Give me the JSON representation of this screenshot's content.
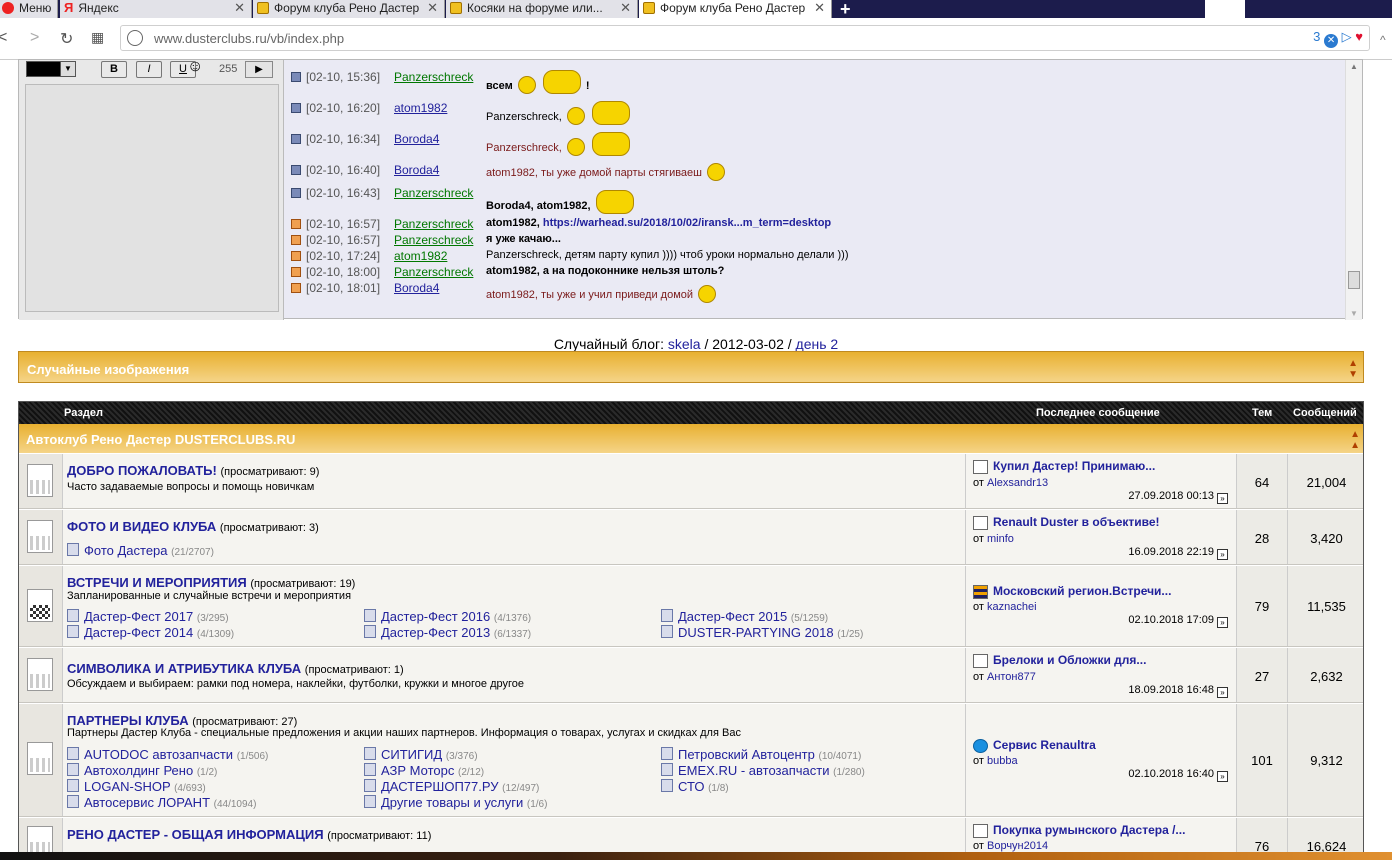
{
  "browser": {
    "tabs": [
      {
        "label": "Меню"
      },
      {
        "label": "Яндекс"
      },
      {
        "label": "Форум клуба Рено Дастер"
      },
      {
        "label": "Косяки на форуме или..."
      },
      {
        "label": "Форум клуба Рено Дастер"
      }
    ],
    "url": "www.dusterclubs.ru/vb/index.php",
    "ext_count": "3"
  },
  "chat": {
    "editor": {
      "bold": "B",
      "italic": "I",
      "underline": "U",
      "char_count": "255"
    },
    "messages": [
      {
        "time": "[02-10, 15:36]",
        "user": "Panzerschreck",
        "text": "всем",
        "style": "bold"
      },
      {
        "time": "[02-10, 16:20]",
        "user": "atom1982",
        "text": "Panzerschreck,",
        "style": "normal"
      },
      {
        "time": "[02-10, 16:34]",
        "user": "Boroda4",
        "text": "Panzerschreck,",
        "style": "red"
      },
      {
        "time": "[02-10, 16:40]",
        "user": "Boroda4",
        "text": "atom1982, ты уже домой парты стягиваеш",
        "style": "red"
      },
      {
        "time": "[02-10, 16:43]",
        "user": "Panzerschreck",
        "text": "Boroda4, atom1982,",
        "style": "bold"
      },
      {
        "time": "[02-10, 16:57]",
        "user": "Panzerschreck",
        "text": "atom1982,",
        "link": "https://warhead.su/2018/10/02/iransk...m_term=desktop",
        "style": "bold"
      },
      {
        "time": "[02-10, 16:57]",
        "user": "Panzerschreck",
        "text": "я уже качаю...",
        "style": "bold"
      },
      {
        "time": "[02-10, 17:24]",
        "user": "atom1982",
        "text": "Panzerschreck, детям парту купил )))) чтоб уроки нормально делали )))",
        "style": "normal"
      },
      {
        "time": "[02-10, 18:00]",
        "user": "Panzerschreck",
        "text": "atom1982, а на подоконнике нельзя штоль?",
        "style": "bold"
      },
      {
        "time": "[02-10, 18:01]",
        "user": "Boroda4",
        "text": "atom1982, ты уже и учил приведи домой",
        "style": "red"
      }
    ]
  },
  "random_blog": {
    "label": "Случайный блог:",
    "author": "skela",
    "date": "/ 2012-03-02 /",
    "title": "день 2"
  },
  "random_images": {
    "title": "Случайные изображения"
  },
  "forum": {
    "headers": {
      "section": "Раздел",
      "last": "Последнее сообщение",
      "threads": "Тем",
      "posts": "Сообщений"
    },
    "category": "Автоклуб Рено Дастер DUSTERCLUBS.RU",
    "rows": [
      {
        "title": "ДОБРО ПОЖАЛОВАТЬ!",
        "viewing": "(просматривают: 9)",
        "desc": "Часто задаваемые вопросы и помощь новичкам",
        "last_title": "Купил Дастер! Принимаю...",
        "last_by": "от",
        "last_user": "Alexsandr13",
        "last_date": "27.09.2018 00:13",
        "threads": "64",
        "posts": "21,004"
      },
      {
        "title": "ФОТО И ВИДЕО КЛУБА",
        "viewing": "(просматривают: 3)",
        "subs": [
          {
            "name": "Фото Дастера",
            "n": "(21/2707)"
          }
        ],
        "last_title": "Renault Duster в объективе!",
        "last_by": "от",
        "last_user": "minfo",
        "last_date": "16.09.2018 22:19",
        "threads": "28",
        "posts": "3,420"
      },
      {
        "title": "ВСТРЕЧИ И МЕРОПРИЯТИЯ",
        "viewing": "(просматривают: 19)",
        "desc": "Запланированные и случайные встречи и мероприятия",
        "subs": [
          {
            "name": "Дастер-Фест 2017",
            "n": "(3/295)"
          },
          {
            "name": "Дастер-Фест 2016",
            "n": "(4/1376)"
          },
          {
            "name": "Дастер-Фест 2015",
            "n": "(5/1259)"
          },
          {
            "name": "Дастер-Фест 2014",
            "n": "(4/1309)"
          },
          {
            "name": "Дастер-Фест 2013",
            "n": "(6/1337)"
          },
          {
            "name": "DUSTER-PARTYING 2018",
            "n": "(1/25)"
          }
        ],
        "last_title": "Московский регион.Встречи...",
        "last_by": "от",
        "last_user": "kaznachei",
        "last_date": "02.10.2018 17:09",
        "threads": "79",
        "posts": "11,535"
      },
      {
        "title": "СИМВОЛИКА И АТРИБУТИКА КЛУБА",
        "viewing": "(просматривают: 1)",
        "desc": "Обсуждаем и выбираем: рамки под номера, наклейки, футболки, кружки и многое другое",
        "last_title": "Брелоки и Обложки для...",
        "last_by": "от",
        "last_user": "Антон877",
        "last_date": "18.09.2018 16:48",
        "threads": "27",
        "posts": "2,632"
      },
      {
        "title": "ПАРТНЕРЫ КЛУБА",
        "viewing": "(просматривают: 27)",
        "desc": "Партнеры Дастер Клуба - специальные предложения и акции наших партнеров. Информация о товарах, услугах и скидках для Вас",
        "subs": [
          {
            "name": "AUTODOC автозапчасти",
            "n": "(1/506)"
          },
          {
            "name": "СИТИГИД",
            "n": "(3/376)"
          },
          {
            "name": "Петровский Автоцентр",
            "n": "(10/4071)"
          },
          {
            "name": "Автохолдинг Рено",
            "n": "(1/2)"
          },
          {
            "name": "АЗР Моторс",
            "n": "(2/12)"
          },
          {
            "name": "EMEX.RU - автозапчасти",
            "n": "(1/280)"
          },
          {
            "name": "LOGAN-SHOP",
            "n": "(4/693)"
          },
          {
            "name": "ДАСТЕРШОП77.РУ",
            "n": "(12/497)"
          },
          {
            "name": "СТО",
            "n": "(1/8)"
          },
          {
            "name": "Автосервис ЛОРАНТ",
            "n": "(44/1094)"
          },
          {
            "name": "Другие товары и услуги",
            "n": "(1/6)"
          }
        ],
        "last_title": "Сервис Renaultra",
        "last_by": "от",
        "last_user": "bubba",
        "last_date": "02.10.2018 16:40",
        "threads": "101",
        "posts": "9,312"
      },
      {
        "title": "РЕНО ДАСТЕР - ОБЩАЯ ИНФОРМАЦИЯ",
        "viewing": "(просматривают: 11)",
        "last_title": "Покупка румынского Дастера /...",
        "last_by": "от",
        "last_user": "Ворчун2014",
        "threads": "76",
        "posts": "16,624"
      }
    ]
  }
}
